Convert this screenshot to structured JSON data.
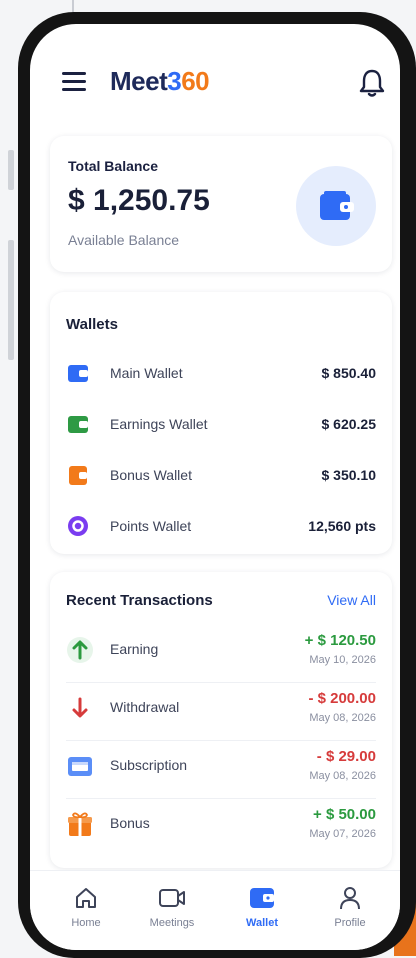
{
  "app": {
    "brand_part1": "Meet",
    "brand_part2": "3",
    "brand_part3": "60"
  },
  "header": {
    "menu_icon": "hamburger-menu-icon",
    "bell_icon": "bell-icon"
  },
  "balance": {
    "label": "Total Balance",
    "value": "$ 1,250.75",
    "sublabel": "Available Balance",
    "icon": "wallet-icon"
  },
  "wallets": {
    "title": "Wallets",
    "items": [
      {
        "name": "Main Wallet",
        "amount": "$ 850.40",
        "icon": "wallet-icon",
        "color": "#2f6bf5"
      },
      {
        "name": "Earnings Wallet",
        "amount": "$ 620.25",
        "icon": "wallet-icon",
        "color": "#2e9a44"
      },
      {
        "name": "Bonus Wallet",
        "amount": "$ 350.10",
        "icon": "wallet-icon",
        "color": "#f27a1a"
      },
      {
        "name": "Points Wallet",
        "amount": "12,560 pts",
        "icon": "points-icon",
        "color": "#7a3cf0"
      }
    ]
  },
  "transactions": {
    "title": "Recent Transactions",
    "view_all": "View All",
    "items": [
      {
        "name": "Earning",
        "amount": "+ $ 120.50",
        "date": "May 10, 2026",
        "icon": "arrow-up-icon"
      },
      {
        "name": "Withdrawal",
        "amount": "- $ 200.00",
        "date": "May 08, 2026",
        "icon": "arrow-down-icon"
      },
      {
        "name": "Subscription",
        "amount": "- $ 29.00",
        "date": "May 08, 2026",
        "icon": "card-icon"
      },
      {
        "name": "Bonus",
        "amount": "+ $ 50.00",
        "date": "May 07, 2026",
        "icon": "gift-icon"
      }
    ]
  },
  "nav": {
    "items": [
      {
        "label": "Home",
        "icon": "home-icon"
      },
      {
        "label": "Meetings",
        "icon": "video-icon"
      },
      {
        "label": "Wallet",
        "icon": "wallet-icon",
        "active": true
      },
      {
        "label": "Profile",
        "icon": "profile-icon"
      }
    ]
  },
  "colors": {
    "accent": "#2f6bf5",
    "brand_orange": "#f27a1a",
    "positive": "#2b9a3f",
    "negative": "#d63b3b"
  }
}
